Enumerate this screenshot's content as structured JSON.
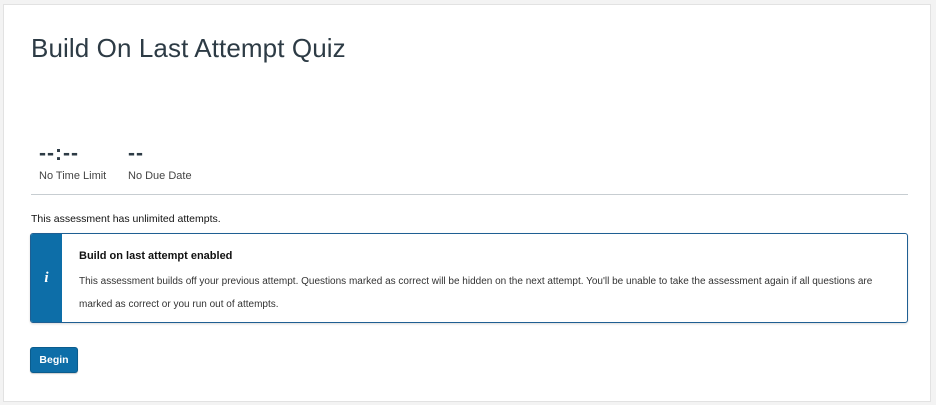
{
  "quiz": {
    "title": "Build On Last Attempt Quiz"
  },
  "stats": {
    "time_limit_value": "--:--",
    "time_limit_label": "No Time Limit",
    "due_date_value": "--",
    "due_date_label": "No Due Date"
  },
  "attempts": {
    "text": "This assessment has unlimited attempts."
  },
  "info_box": {
    "icon": "info-icon",
    "icon_glyph": "i",
    "heading": "Build on last attempt enabled",
    "body": "This assessment builds off your previous attempt. Questions marked as correct will be hidden on the next attempt. You'll be unable to take the assessment again if all questions are marked as correct or you run out of attempts."
  },
  "actions": {
    "begin_label": "Begin"
  },
  "colors": {
    "accent": "#0d6ea8",
    "info_border": "#1f5f93",
    "text": "#2d3b45"
  }
}
